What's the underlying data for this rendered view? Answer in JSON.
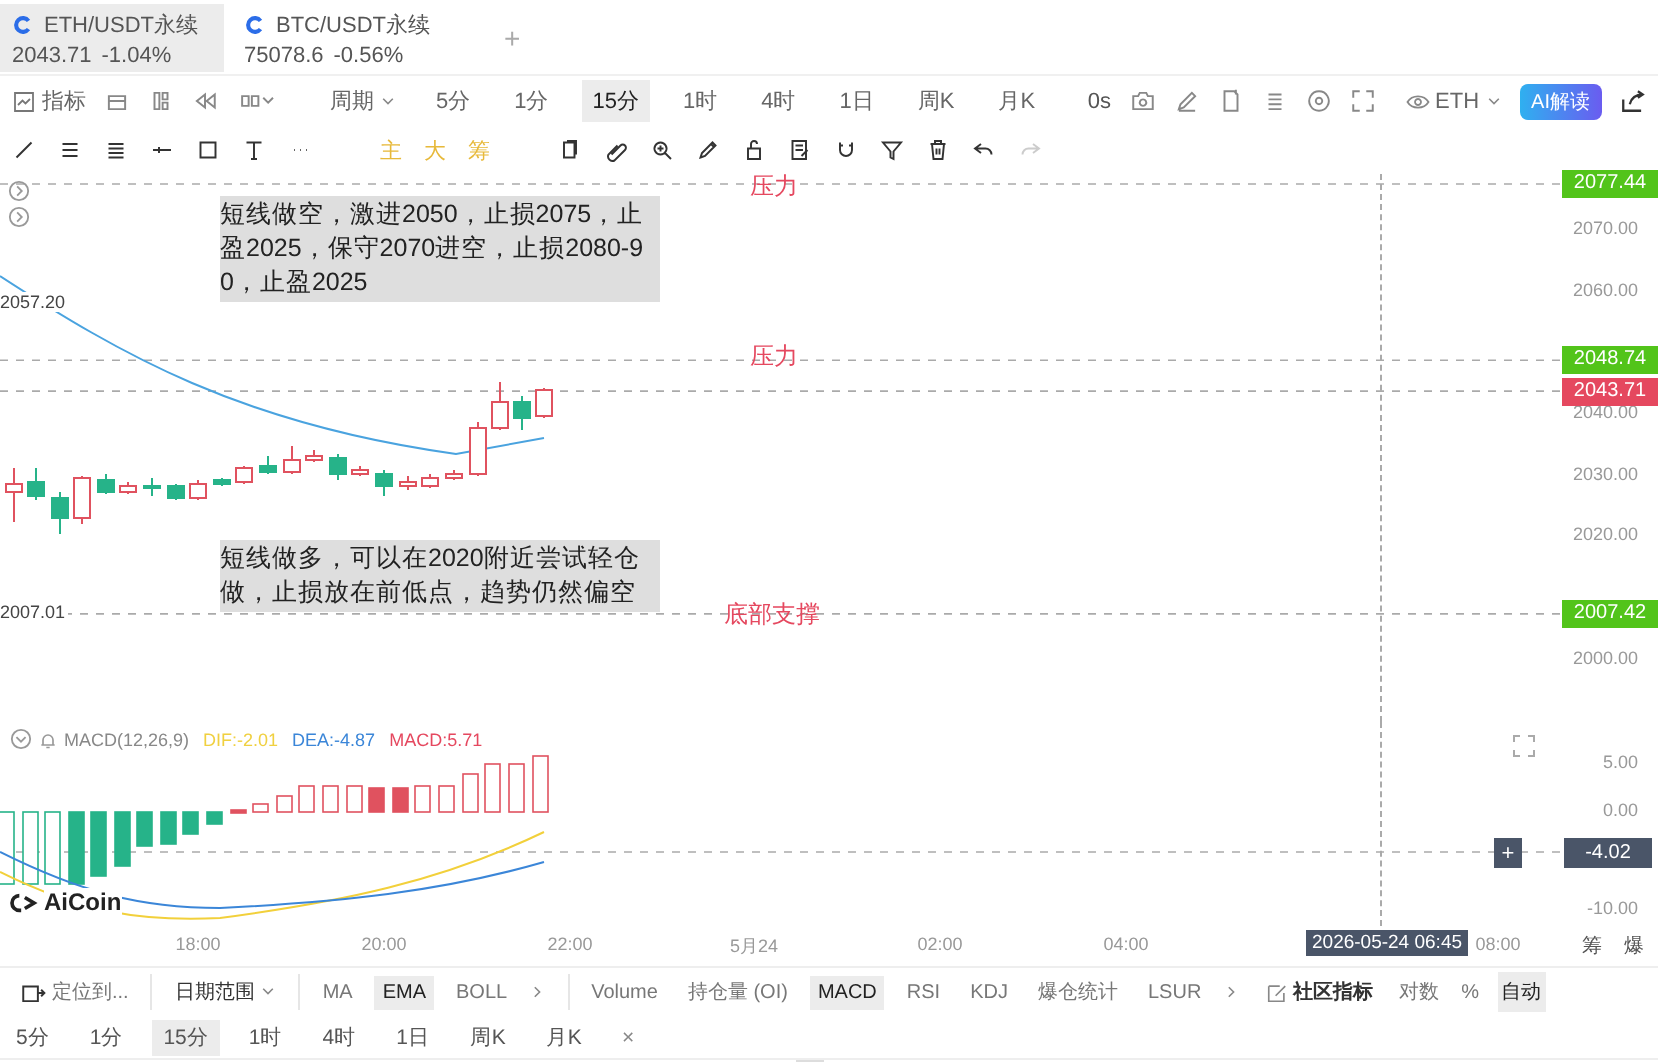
{
  "tabs": [
    {
      "symbol": "ETH/USDT永续",
      "price": "2043.71",
      "change": "-1.04%",
      "selected": true
    },
    {
      "symbol": "BTC/USDT永续",
      "price": "75078.6",
      "change": "-0.56%",
      "selected": false
    }
  ],
  "add_tab": "+",
  "toolbar": {
    "indicator_label": "指标",
    "period_label": "周期",
    "periods": [
      {
        "label": "5分",
        "selected": false
      },
      {
        "label": "1分",
        "selected": false
      },
      {
        "label": "15分",
        "selected": true
      },
      {
        "label": "1时",
        "selected": false
      },
      {
        "label": "4时",
        "selected": false
      },
      {
        "label": "1日",
        "selected": false
      },
      {
        "label": "周K",
        "selected": false
      },
      {
        "label": "月K",
        "selected": false
      }
    ],
    "countdown": "0s",
    "symbol_select": "ETH",
    "ai_button": "AI解读"
  },
  "drawing_tools": {
    "text_tools": [
      "主",
      "大",
      "筹"
    ]
  },
  "chart": {
    "price_ticks": [
      "2070.00",
      "2060.00",
      "2040.00",
      "2030.00",
      "2020.00",
      "2000.00"
    ],
    "price_tags": [
      {
        "value": "2077.44",
        "color": "#52c41a"
      },
      {
        "value": "2048.74",
        "color": "#52c41a"
      },
      {
        "value": "2043.71",
        "color": "#e5485f"
      },
      {
        "value": "2007.42",
        "color": "#52c41a"
      }
    ],
    "extreme_labels": [
      "2057.20",
      "2007.01"
    ],
    "zone_labels": [
      "压力",
      "压力",
      "底部支撑"
    ],
    "notes": [
      "短线做空，激进2050，止损2075，止盈2025，保守2070进空，止损2080-90，止盈2025",
      "短线做多，可以在2020附近尝试轻仓做，止损放在前低点，趋势仍然偏空"
    ]
  },
  "macd": {
    "title": "MACD(12,26,9)",
    "dif": "DIF:-2.01",
    "dea": "DEA:-4.87",
    "macd": "MACD:5.71",
    "ticks": [
      "5.00",
      "0.00",
      "-10.00"
    ],
    "crosshair_plus": "+",
    "crosshair_value": "-4.02"
  },
  "logo": "AiCoin",
  "time_axis": {
    "labels": [
      "18:00",
      "20:00",
      "22:00",
      "5月24",
      "02:00",
      "04:00",
      "08:00"
    ],
    "crosshair_time": "2026-05-24 06:45",
    "side_labels": [
      "筹",
      "爆"
    ]
  },
  "bottom_bar": {
    "locate": "定位到...",
    "date_range": "日期范围",
    "main_indicators": [
      {
        "label": "MA",
        "selected": false
      },
      {
        "label": "EMA",
        "selected": true
      },
      {
        "label": "BOLL",
        "selected": false
      }
    ],
    "sub_indicators": [
      {
        "label": "Volume",
        "selected": false
      },
      {
        "label": "持仓量 (OI)",
        "selected": false
      },
      {
        "label": "MACD",
        "selected": true
      },
      {
        "label": "RSI",
        "selected": false
      },
      {
        "label": "KDJ",
        "selected": false
      },
      {
        "label": "爆仓统计",
        "selected": false
      },
      {
        "label": "LSUR",
        "selected": false
      }
    ],
    "community": "社区指标",
    "scale_options": [
      {
        "label": "对数",
        "selected": false
      },
      {
        "label": "%",
        "selected": false
      },
      {
        "label": "自动",
        "selected": true
      }
    ]
  },
  "period_bar": {
    "periods": [
      {
        "label": "5分",
        "selected": false
      },
      {
        "label": "1分",
        "selected": false
      },
      {
        "label": "15分",
        "selected": true
      },
      {
        "label": "1时",
        "selected": false
      },
      {
        "label": "4时",
        "selected": false
      },
      {
        "label": "1日",
        "selected": false
      },
      {
        "label": "周K",
        "selected": false
      },
      {
        "label": "月K",
        "selected": false
      }
    ],
    "close": "×"
  }
}
